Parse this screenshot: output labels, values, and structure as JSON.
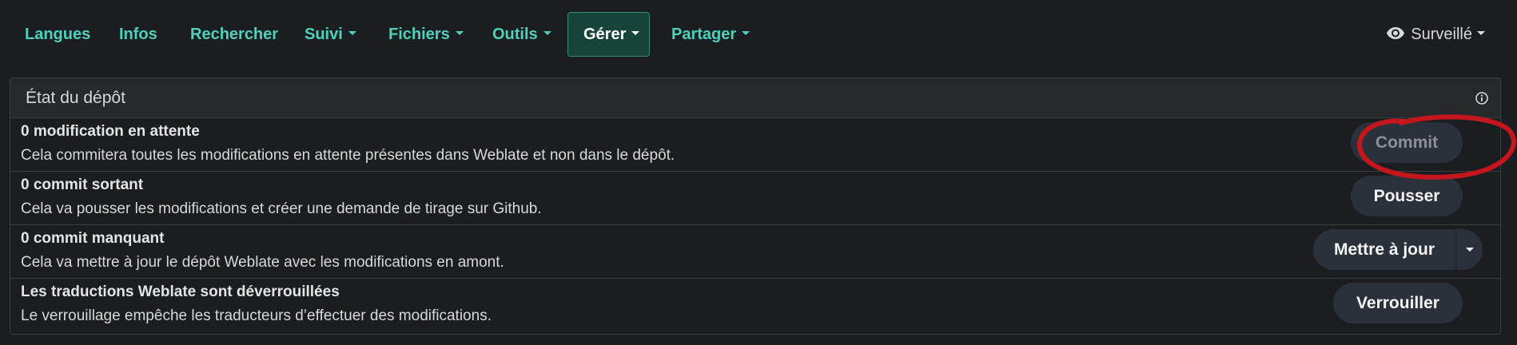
{
  "nav": {
    "items": [
      {
        "label": "Langues",
        "dropdown": false
      },
      {
        "label": "Infos",
        "dropdown": false
      },
      {
        "label": "Rechercher",
        "dropdown": false
      },
      {
        "label": "Suivi",
        "dropdown": true
      },
      {
        "label": "Fichiers",
        "dropdown": true
      },
      {
        "label": "Outils",
        "dropdown": true
      },
      {
        "label": "Gérer",
        "dropdown": true,
        "active": true
      },
      {
        "label": "Partager",
        "dropdown": true
      }
    ],
    "watch_label": "Surveillé"
  },
  "panel": {
    "title": "État du dépôt",
    "rows": [
      {
        "title": "0 modification en attente",
        "description": "Cela commitera toutes les modifications en attente présentes dans Weblate et non dans le dépôt.",
        "button": "Commit",
        "button_disabled": true
      },
      {
        "title": "0 commit sortant",
        "description": "Cela va pousser les modifications et créer une demande de tirage sur Github.",
        "button": "Pousser"
      },
      {
        "title": "0 commit manquant",
        "description": "Cela va mettre à jour le dépôt Weblate avec les modifications en amont.",
        "button": "Mettre à jour",
        "split": true
      },
      {
        "title": "Les traductions Weblate sont déverrouillées",
        "description": "Le verrouillage empêche les traducteurs d’effectuer des modifications.",
        "button": "Verrouiller"
      }
    ]
  },
  "icons": {
    "watch": "eye-icon",
    "info": "info-circle-icon"
  },
  "colors": {
    "background": "#1b1e21",
    "nav_link": "#4fd1b8",
    "active_tab_bg": "#17443a",
    "button_bg": "#2b313a",
    "annotation": "#c4161c"
  }
}
